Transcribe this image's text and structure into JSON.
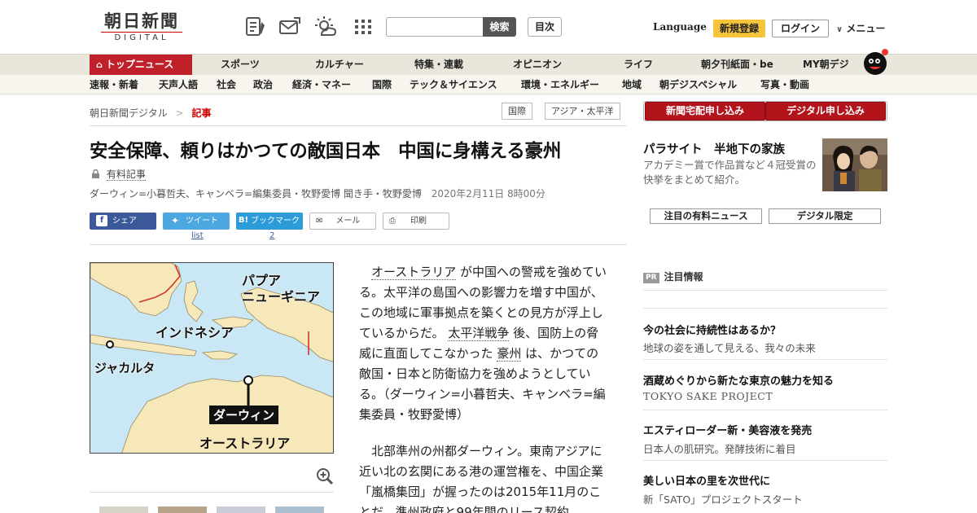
{
  "header": {
    "logo_main": "朝日新聞",
    "logo_sub": "DIGITAL",
    "icons": [
      "newspaper-pen-icon",
      "mail-icon",
      "weather-icon",
      "grid-menu-icon"
    ],
    "search_placeholder": "",
    "search_button": "検索",
    "toc_button": "目次",
    "language": "Language",
    "signup": "新規登録",
    "login": "ログイン",
    "menu": "メニュー"
  },
  "nav_main": {
    "active": "トップニュース",
    "items": [
      "スポーツ",
      "カルチャー",
      "特集・連載",
      "オピニオン",
      "ライフ",
      "朝夕刊紙面・be",
      "MY朝デジ"
    ]
  },
  "nav_sub": {
    "items": [
      "速報・新着",
      "天声人語",
      "社会",
      "政治",
      "経済・マネー",
      "国際",
      "テック＆サイエンス",
      "環境・エネルギー",
      "地域",
      "朝デジスペシャル",
      "写真・動画"
    ]
  },
  "breadcrumb": {
    "home": "朝日新聞デジタル",
    "separator": ">",
    "current": "記事"
  },
  "tags": [
    "国際",
    "アジア・太平洋"
  ],
  "article": {
    "title": "安全保障、頼りはかつての敵国日本　中国に身構える豪州",
    "paid_label": "有料記事",
    "byline": "ダーウィン=小暮哲夫、キャンベラ=編集委員・牧野愛博 聞き手・牧野愛博",
    "date": "2020年2月11日 8時00分",
    "share": {
      "facebook": "シェア",
      "twitter": "ツイート",
      "twitter_count": "list",
      "hatena": "ブックマーク",
      "hatena_count": "2",
      "mail": "メール",
      "print": "印刷"
    },
    "map_labels": {
      "png": "パプア\nニューギニア",
      "indonesia": "インドネシア",
      "jakarta": "ジャカルタ",
      "darwin": "ダーウィン",
      "australia": "オーストラリア"
    },
    "p1": {
      "link1": "オーストラリア",
      "t1": "が中国への警戒を強めている。太平洋の島国への影響力を増す中国が、この地域に軍事拠点を築くとの見方が浮上しているからだ。",
      "link2": "太平洋戦争",
      "t2": "後、国防上の脅威に直面してこなかった",
      "link3": "豪州",
      "t3": "は、かつての敵国・日本と防衛協力を強めようとしている。（ダーウィン=小暮哲夫、キャンベラ=編集委員・牧野愛博）"
    },
    "p2": "北部準州の州都ダーウィン。東南アジアに近い北の玄関にある港の運営権を、中国企業「嵐橋集団」が握ったのは2015年11月のことだ。準州政府と99年間のリース契約"
  },
  "sidebar": {
    "btn_home": "新聞宅配申し込み",
    "btn_digital": "デジタル申し込み",
    "promo_title": "パラサイト　半地下の家族",
    "promo_desc": "アカデミー賞で作品賞など４冠受賞の快挙をまとめて紹介。",
    "tab1": "注目の有料ニュース",
    "tab2": "デジタル限定",
    "pr_badge": "PR",
    "pr_heading": "注目情報",
    "pr_items": [
      {
        "title": "今の社会に持続性はあるか？",
        "sub": "地球の姿を通して見える、我々の未来"
      },
      {
        "title": "酒蔵めぐりから新たな東京の魅力を知る",
        "sub": "TOKYO SAKE PROJECT"
      },
      {
        "title": "エスティローダー新・美容液を発売",
        "sub": "日本人の肌研究。発酵技術に着目"
      },
      {
        "title": "美しい日本の里を次世代に",
        "sub": "新「SATO」プロジェクトスタート"
      }
    ]
  },
  "colors": {
    "brand_red": "#c0202a",
    "signup_yellow": "#f5c43a",
    "facebook": "#3b5998",
    "twitter": "#4da7e0",
    "hatena": "#2c9bd8"
  }
}
